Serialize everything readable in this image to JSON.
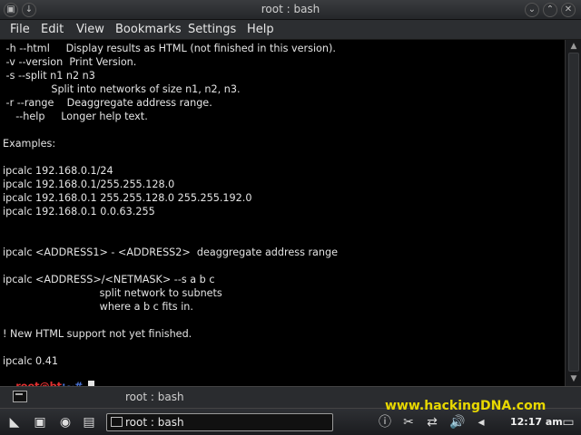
{
  "window": {
    "title": "root : bash"
  },
  "menu": {
    "items": [
      "File",
      "Edit",
      "View",
      "Bookmarks",
      "Settings",
      "Help"
    ]
  },
  "terminal": {
    "lines": [
      " -h --html     Display results as HTML (not finished in this version).",
      " -v --version  Print Version.",
      " -s --split n1 n2 n3",
      "               Split into networks of size n1, n2, n3.",
      " -r --range    Deaggregate address range.",
      "    --help     Longer help text.",
      "",
      "Examples:",
      "",
      "ipcalc 192.168.0.1/24",
      "ipcalc 192.168.0.1/255.255.128.0",
      "ipcalc 192.168.0.1 255.255.128.0 255.255.192.0",
      "ipcalc 192.168.0.1 0.0.63.255",
      "",
      "",
      "ipcalc <ADDRESS1> - <ADDRESS2>  deaggregate address range",
      "",
      "ipcalc <ADDRESS>/<NETMASK> --s a b c",
      "                              split network to subnets",
      "                              where a b c fits in.",
      "",
      "! New HTML support not yet finished.",
      "",
      "ipcalc 0.41"
    ],
    "prompt": {
      "user_host": "root@bt",
      "path": ":~# "
    }
  },
  "tabbar": {
    "tab_label": "root : bash"
  },
  "watermark": "www.hackingDNA.com",
  "taskbar": {
    "task_label": "root : bash",
    "clock": "12:17 am"
  },
  "colors": {
    "prompt_user": "#e03030",
    "prompt_path": "#4a74d8",
    "watermark": "#e8d800"
  }
}
